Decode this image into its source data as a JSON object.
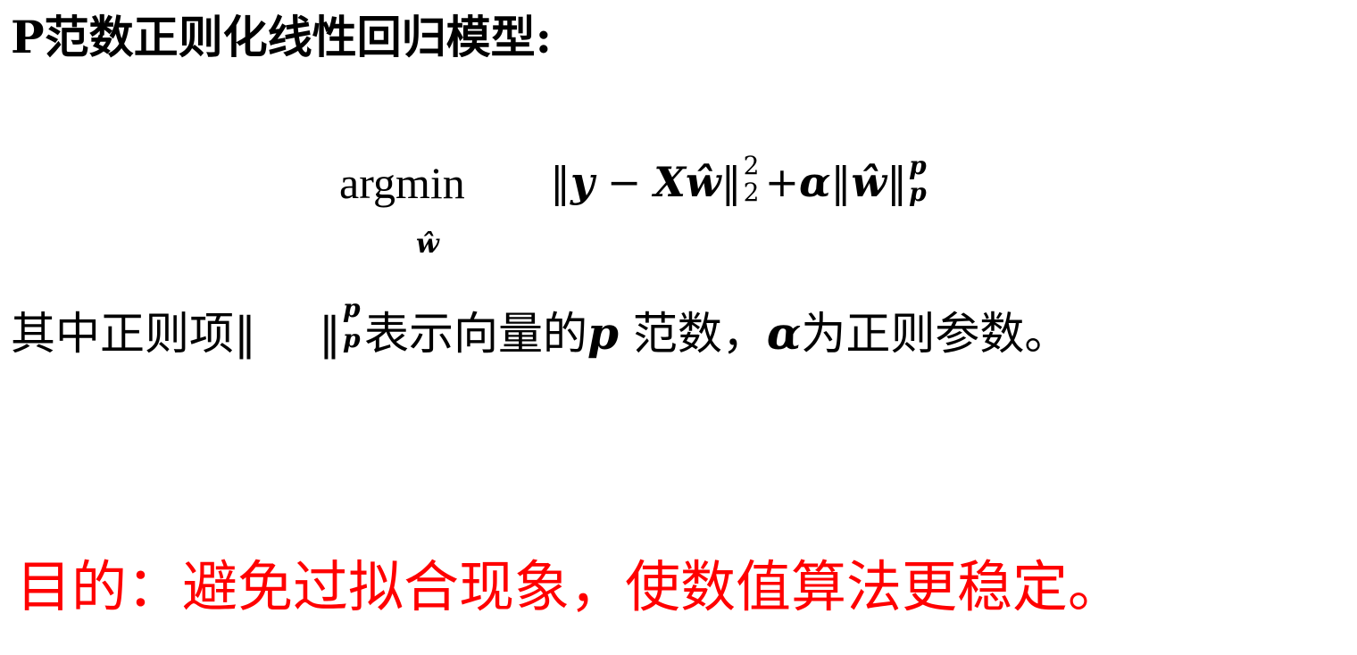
{
  "title": "P范数正则化线性回归模型:",
  "formula": {
    "operator": "argmin",
    "operator_subscript": "ŵ",
    "norm_open": "‖",
    "y": "y",
    "minus": "−",
    "X": "X",
    "w_hat": "ŵ",
    "norm_close": "‖",
    "sq_sup": "2",
    "sq_sub": "2",
    "plus": "+",
    "alpha": "α",
    "norm_open2": "‖",
    "w_hat2": "ŵ",
    "norm_close2": "‖",
    "p_sup": "p",
    "p_sub": "p"
  },
  "explanation": {
    "part1": "其中正则项‖",
    "norm_close": "‖",
    "p_sup": "p",
    "p_sub": "p",
    "part2": "表示向量的",
    "p": "p",
    "part3": " 范数，",
    "alpha": "α",
    "part4": "为正则参数。"
  },
  "purpose": "目的：避免过拟合现象，使数值算法更稳定。",
  "colors": {
    "text": "#000000",
    "purpose": "#ff0000",
    "background": "#ffffff"
  }
}
